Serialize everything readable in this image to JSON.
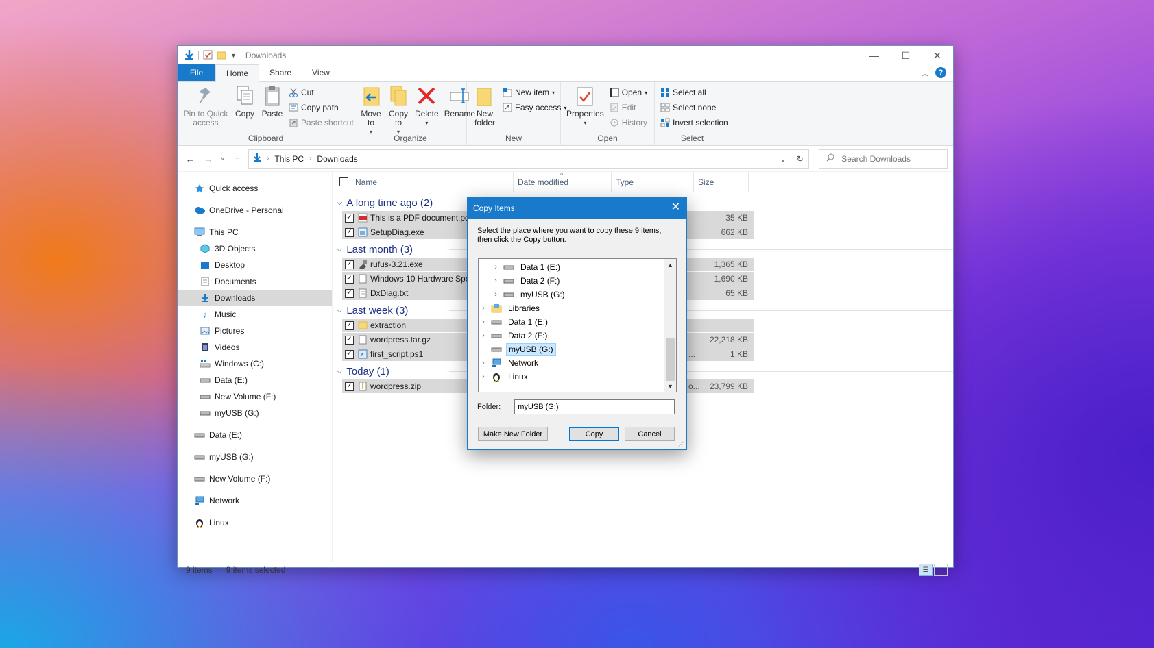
{
  "window": {
    "title": "Downloads"
  },
  "tabs": [
    "File",
    "Home",
    "Share",
    "View"
  ],
  "ribbon": {
    "clipboard": {
      "label": "Clipboard",
      "pin": "Pin to Quick access",
      "copy": "Copy",
      "paste": "Paste",
      "cut": "Cut",
      "copy_path": "Copy path",
      "paste_shortcut": "Paste shortcut"
    },
    "organize": {
      "label": "Organize",
      "move_to": "Move to",
      "copy_to": "Copy to",
      "delete": "Delete",
      "rename": "Rename"
    },
    "new": {
      "label": "New",
      "new_folder": "New folder",
      "new_item": "New item",
      "easy_access": "Easy access"
    },
    "open": {
      "label": "Open",
      "properties": "Properties",
      "open": "Open",
      "edit": "Edit",
      "history": "History"
    },
    "select": {
      "label": "Select",
      "select_all": "Select all",
      "select_none": "Select none",
      "invert": "Invert selection"
    }
  },
  "address": {
    "crumbs": [
      "This PC",
      "Downloads"
    ],
    "search_placeholder": "Search Downloads"
  },
  "sidebar": {
    "quick_access": "Quick access",
    "onedrive": "OneDrive - Personal",
    "this_pc": "This PC",
    "pc_items": [
      "3D Objects",
      "Desktop",
      "Documents",
      "Downloads",
      "Music",
      "Pictures",
      "Videos",
      "Windows (C:)",
      "Data (E:)",
      "New Volume (F:)",
      "myUSB (G:)"
    ],
    "drives": [
      "Data (E:)",
      "myUSB (G:)",
      "New Volume (F:)"
    ],
    "network": "Network",
    "linux": "Linux"
  },
  "columns": {
    "name": "Name",
    "date": "Date modified",
    "type": "Type",
    "size": "Size"
  },
  "groups": [
    {
      "title": "A long time ago (2)",
      "files": [
        {
          "name": "This is a PDF document.pdf",
          "type": "",
          "size": "35 KB"
        },
        {
          "name": "SetupDiag.exe",
          "type": "",
          "size": "662 KB"
        }
      ]
    },
    {
      "title": "Last month (3)",
      "files": [
        {
          "name": "rufus-3.21.exe",
          "type": "",
          "size": "1,365 KB"
        },
        {
          "name": "Windows 10 Hardware Spe",
          "type": "",
          "size": "1,690 KB"
        },
        {
          "name": "DxDiag.txt",
          "type": "",
          "size": "65 KB"
        }
      ]
    },
    {
      "title": "Last week (3)",
      "files": [
        {
          "name": "extraction",
          "type": "",
          "size": ""
        },
        {
          "name": "wordpress.tar.gz",
          "type": "",
          "size": "22,218 KB"
        },
        {
          "name": "first_script.ps1",
          "type": "...",
          "size": "1 KB"
        }
      ]
    },
    {
      "title": "Today (1)",
      "files": [
        {
          "name": "wordpress.zip",
          "type": "o...",
          "size": "23,799 KB"
        }
      ]
    }
  ],
  "status": {
    "count": "9 items",
    "selected": "9 items selected"
  },
  "dialog": {
    "title": "Copy Items",
    "instructions": "Select the place where you want to copy these 9 items, then click the Copy button.",
    "tree": [
      {
        "label": "Data 1 (E:)",
        "indent": 1
      },
      {
        "label": "Data 2 (F:)",
        "indent": 1
      },
      {
        "label": "myUSB (G:)",
        "indent": 1
      },
      {
        "label": "Libraries",
        "indent": 0
      },
      {
        "label": "Data 1 (E:)",
        "indent": 0
      },
      {
        "label": "Data 2 (F:)",
        "indent": 0
      },
      {
        "label": "myUSB (G:)",
        "indent": 0,
        "selected": true
      },
      {
        "label": "Network",
        "indent": 0
      },
      {
        "label": "Linux",
        "indent": 0
      }
    ],
    "folder_label": "Folder:",
    "folder_value": "myUSB (G:)",
    "make_new_folder": "Make New Folder",
    "copy": "Copy",
    "cancel": "Cancel"
  },
  "colors": {
    "accent": "#1979ca",
    "selection": "#d9d9d9",
    "group_header": "#1e3287"
  }
}
